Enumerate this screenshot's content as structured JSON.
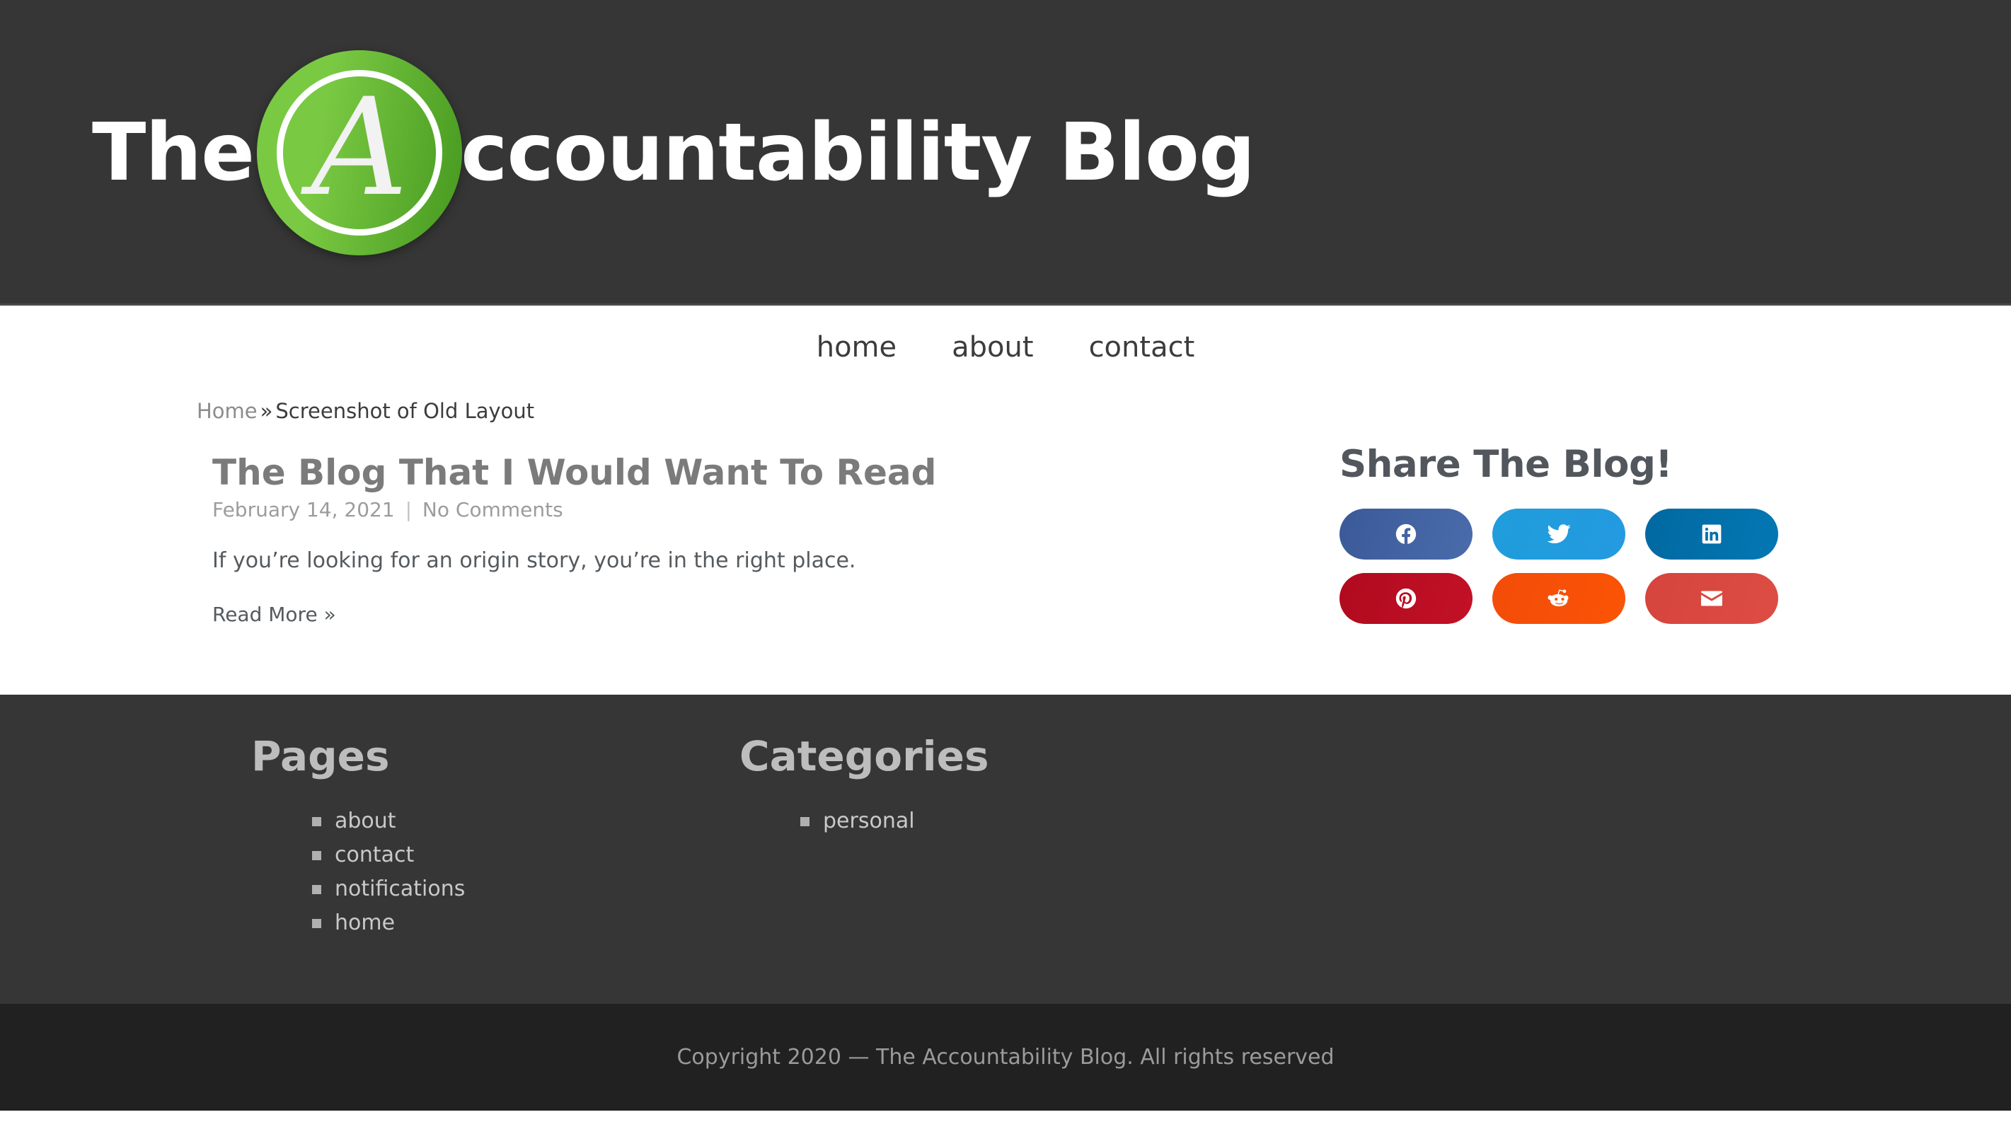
{
  "header": {
    "brand_prefix": "The",
    "brand_logo_letter": "A",
    "brand_suffix": "ccountability Blog",
    "logo_name": "accountability-a-logo",
    "bg_color": "#363636",
    "logo_green_light": "#7ac943",
    "logo_green_dark": "#46991f"
  },
  "nav": {
    "items": [
      {
        "label": "home"
      },
      {
        "label": "about"
      },
      {
        "label": "contact"
      }
    ]
  },
  "breadcrumb": {
    "home_label": "Home",
    "separator": "»",
    "current": "Screenshot of Old Layout"
  },
  "post": {
    "title": "The Blog That I Would Want To Read",
    "date": "February 14, 2021",
    "meta_separator": "|",
    "comments": "No Comments",
    "excerpt": "If you’re looking for an origin story, you’re in the right place.",
    "read_more": "Read More »"
  },
  "share": {
    "heading": "Share The Blog!",
    "buttons": [
      {
        "name": "facebook",
        "label": "Facebook",
        "color": "#3b5998",
        "color_end": "#4a6cab"
      },
      {
        "name": "twitter",
        "label": "Twitter",
        "color": "#1f9ddb",
        "color_end": "#249ae0"
      },
      {
        "name": "linkedin",
        "label": "LinkedIn",
        "color": "#0268a0",
        "color_end": "#0378b4"
      },
      {
        "name": "pinterest",
        "label": "Pinterest",
        "color": "#b00a1e",
        "color_end": "#c31127"
      },
      {
        "name": "reddit",
        "label": "Reddit",
        "color": "#f34c09",
        "color_end": "#fb5406"
      },
      {
        "name": "email",
        "label": "Email",
        "color": "#d5443d",
        "color_end": "#dd4d44"
      }
    ]
  },
  "footer": {
    "widgets": [
      {
        "title": "Pages",
        "items": [
          {
            "label": "about"
          },
          {
            "label": "contact"
          },
          {
            "label": "notifications"
          },
          {
            "label": "home"
          }
        ]
      },
      {
        "title": "Categories",
        "items": [
          {
            "label": "personal"
          }
        ]
      }
    ],
    "copyright": "Copyright 2020 — The Accountability Blog. All rights reserved"
  }
}
